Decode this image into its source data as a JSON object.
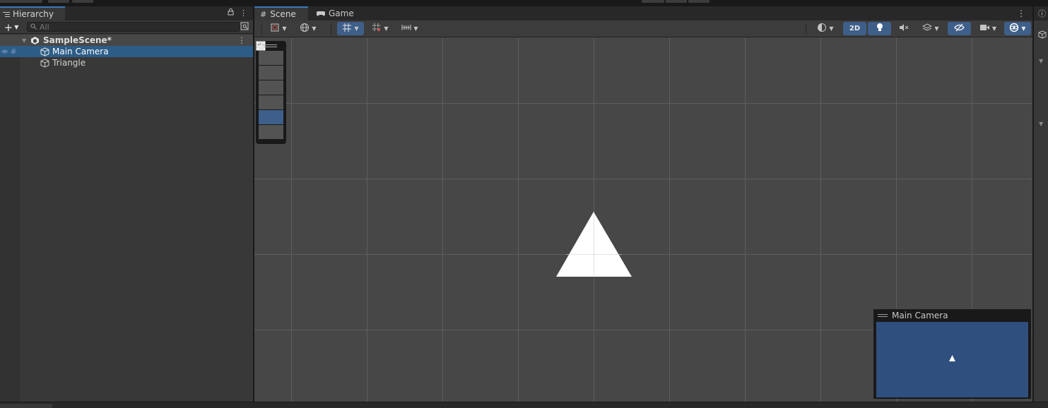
{
  "hierarchy": {
    "tab_label": "Hierarchy",
    "search_placeholder": "All",
    "scene_name": "SampleScene*",
    "items": [
      {
        "label": "Main Camera",
        "selected": true
      },
      {
        "label": "Triangle",
        "selected": false
      }
    ]
  },
  "scene_view": {
    "tabs": [
      {
        "label": "Scene",
        "icon": "grid-hash-icon",
        "active": true
      },
      {
        "label": "Game",
        "icon": "gamepad-icon",
        "active": false
      }
    ],
    "toolbar": {
      "mode_2d_label": "2D"
    },
    "tools": [
      "hand-tool",
      "move-tool",
      "rotate-tool",
      "scale-tool",
      "rect-tool",
      "transform-tool"
    ],
    "active_tool": "rect-tool",
    "camera_preview_title": "Main Camera"
  },
  "colors": {
    "accent": "#3a79bb",
    "selection": "#2c5d87",
    "toggle_on": "#3e5f8a",
    "viewport_bg": "#474747",
    "camera_bg": "#2f4f7e"
  }
}
